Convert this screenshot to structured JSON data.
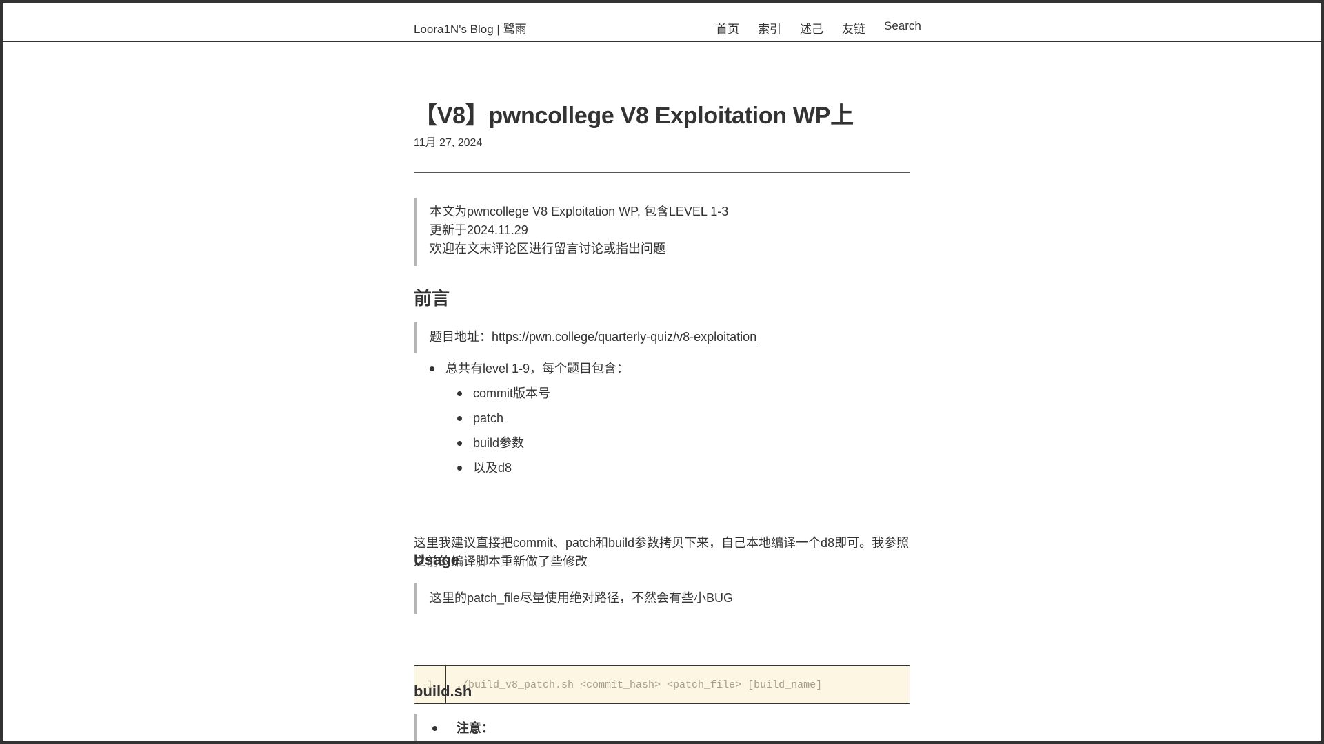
{
  "header": {
    "site_title": "Loora1N's Blog | 鹭雨",
    "nav": [
      "首页",
      "索引",
      "述己",
      "友链",
      "Search"
    ]
  },
  "post": {
    "title": "【V8】pwncollege V8 Exploitation WP上",
    "date": "11月 27, 2024",
    "intro_quote": [
      "本文为pwncollege V8 Exploitation WP, 包含LEVEL 1-3",
      "更新于2024.11.29",
      "欢迎在文末评论区进行留言讨论或指出问题"
    ],
    "section_preface": "前言",
    "address_prefix": "题目地址：",
    "address_link": "https://pwn.college/quarterly-quiz/v8-exploitation",
    "list_top": "总共有level 1-9，每个题目包含：",
    "list_sub": [
      "commit版本号",
      "patch",
      "build参数",
      "以及d8"
    ],
    "paragraph": "这里我建议直接把commit、patch和build参数拷贝下来，自己本地编译一个d8即可。我参照之前的编译脚本重新做了些修改",
    "section_usage": "Usage",
    "usage_quote": "这里的patch_file尽量使用绝对路径，不然会有些小BUG",
    "code_line_number": "1",
    "code_line": "./build_v8_patch.sh <commit_hash> <patch_file> [build_name]",
    "section_build": "build.sh",
    "notice_label": "注意："
  }
}
